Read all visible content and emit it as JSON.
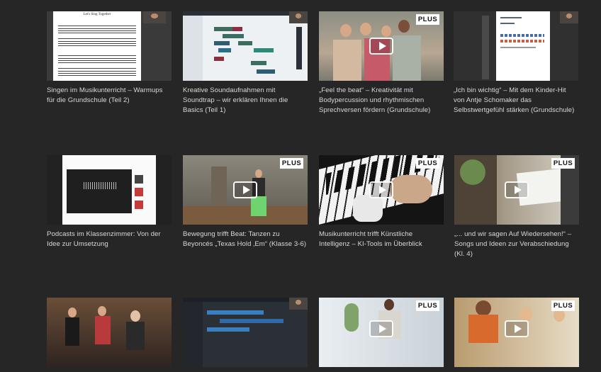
{
  "grid": {
    "cards": [
      {
        "title": "Singen im Musikunterricht – Warmups für die Grundschule (Teil 2)",
        "plus": false,
        "sheet_title": "Let's Sing Together"
      },
      {
        "title": "Kreative Soundaufnahmen mit Soundtrap – wir erklären Ihnen die Basics (Teil 1)",
        "plus": false
      },
      {
        "title": "„Feel the beat“ – Kreativität mit Bodypercussion und rhythmischen Sprechversen fördern (Grundschule)",
        "plus": true
      },
      {
        "title": "„Ich bin wichtig“ – Mit dem Kinder-Hit von Antje Schomaker das Selbstwertgefühl stärken (Grundschule)",
        "plus": false
      },
      {
        "title": "Podcasts im Klassenzimmer: Von der Idee zur Umsetzung",
        "plus": false
      },
      {
        "title": "Bewegung trifft Beat: Tanzen zu Beyoncés „Texas Hold ‚Em“ (Klasse 3-6)",
        "plus": true
      },
      {
        "title": "Musikunterricht trifft Künstliche Intelligenz – KI-Tools im Überblick",
        "plus": true
      },
      {
        "title": "„... und wir sagen Auf Wiedersehen!“ – Songs und Ideen zur Verabschiedung (Kl. 4)",
        "plus": true
      },
      {
        "title": "",
        "plus": false
      },
      {
        "title": "",
        "plus": false
      },
      {
        "title": "",
        "plus": true
      },
      {
        "title": "",
        "plus": true
      }
    ],
    "plus_label": "PLUS",
    "icons": {
      "play": "play-icon"
    }
  }
}
